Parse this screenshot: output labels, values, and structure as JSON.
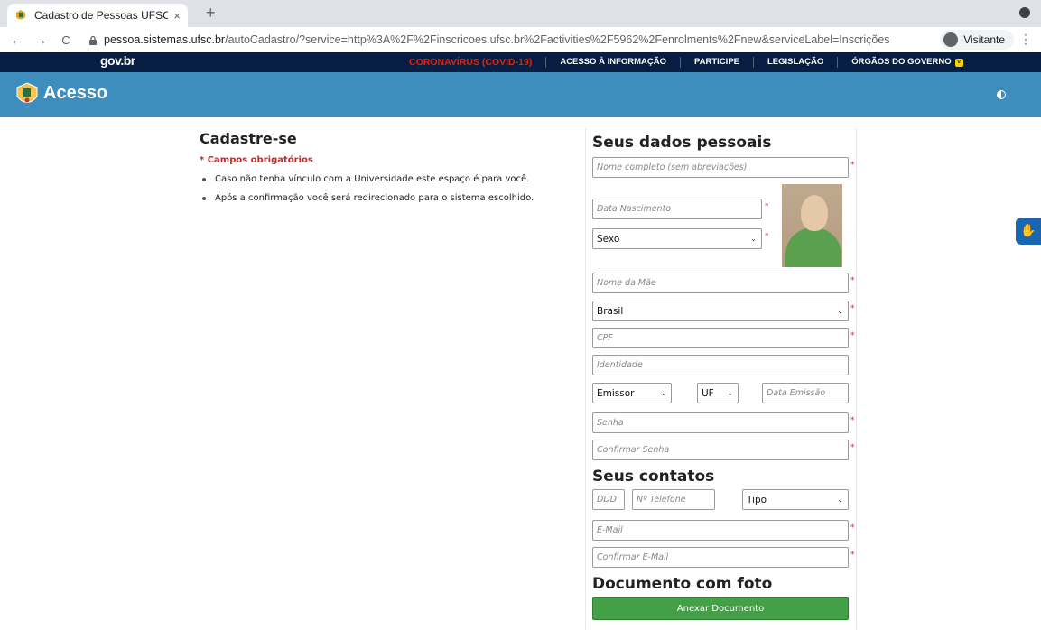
{
  "browser": {
    "tab_title": "Cadastro de Pessoas UFSC |",
    "tab_close": "×",
    "new_tab": "+",
    "back": "←",
    "forward": "→",
    "reload": "C",
    "url_domain": "pessoa.sistemas.ufsc.br",
    "url_path": "/autoCadastro/?service=http%3A%2F%2Finscricoes.ufsc.br%2Factivities%2F5962%2Fenrolments%2Fnew&serviceLabel=Inscrições",
    "profile_label": "Visitante",
    "menu": "⋮"
  },
  "govbar": {
    "logo": "gov.br",
    "links": [
      "CORONAVÍRUS (COVID-19)",
      "ACESSO À INFORMAÇÃO",
      "PARTICIPE",
      "LEGISLAÇÃO",
      "ÓRGÃOS DO GOVERNO"
    ],
    "dropdown_glyph": "˅"
  },
  "header": {
    "title": "Acesso"
  },
  "left": {
    "title": "Cadastre-se",
    "required_note": "* Campos obrigatórios",
    "bullets": [
      "Caso não tenha vínculo com a Universidade este espaço é para você.",
      "Após a confirmação você será redirecionado para o sistema escolhido."
    ]
  },
  "form": {
    "section_personal": "Seus dados pessoais",
    "section_contacts": "Seus contatos",
    "section_document": "Documento com foto",
    "full_name_placeholder": "Nome completo (sem abreviações)",
    "birth_placeholder": "Data Nascimento",
    "sex_value": "Sexo",
    "mother_placeholder": "Nome da Mãe",
    "country_value": "Brasil",
    "cpf_placeholder": "CPF",
    "identity_placeholder": "Identidade",
    "issuer_value": "Emissor",
    "uf_value": "UF",
    "issue_date_placeholder": "Data Emissão",
    "password_placeholder": "Senha",
    "confirm_password_placeholder": "Confirmar Senha",
    "ddd_placeholder": "DDD",
    "phone_placeholder": "Nº Telefone",
    "phone_type_value": "Tipo",
    "email_placeholder": "E-Mail",
    "confirm_email_placeholder": "Confirmar E-Mail",
    "attach_button": "Anexar Documento",
    "required_star": "*",
    "select_arrow": "⌄"
  },
  "accessibility": {
    "vlibras_glyph": "✋"
  },
  "colors": {
    "gov_navy": "#071d41",
    "covid_red": "#e52207",
    "header_blue": "#3d8ebd",
    "required_red": "#c62828",
    "button_green": "#43a047"
  }
}
